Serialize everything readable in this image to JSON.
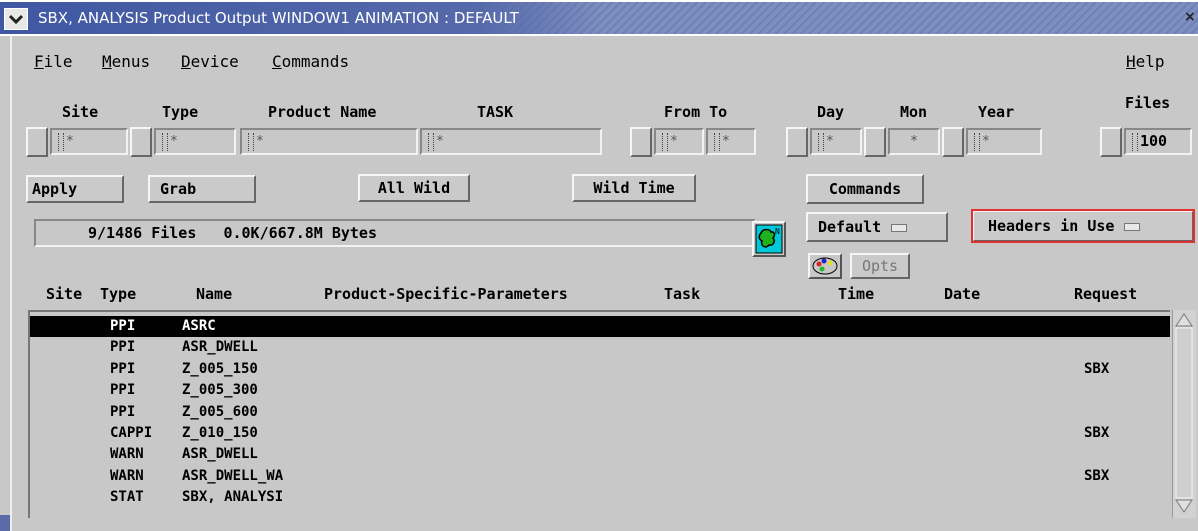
{
  "window": {
    "title": "SBX, ANALYSIS   Product Output WINDOW1 ANIMATION : DEFAULT",
    "close_glyph": "×"
  },
  "menubar": {
    "file": "File",
    "menus": "Menus",
    "device": "Device",
    "commands": "Commands",
    "help": "Help"
  },
  "filters": {
    "site_label": "Site",
    "type_label": "Type",
    "product_name_label": "Product Name",
    "task_label": "TASK",
    "from_to_label": "From To",
    "day_label": "Day",
    "mon_label": "Mon",
    "year_label": "Year",
    "files_label": "Files",
    "site_value": "*",
    "type_value": "*",
    "product_name_value": "*",
    "task_value": "*",
    "from_value": "*",
    "to_value": "*",
    "day_value": "*",
    "mon_value": "*",
    "year_value": "*",
    "files_value": "100"
  },
  "buttons": {
    "apply": "Apply",
    "grab": "Grab",
    "all_wild": "All Wild",
    "wild_time": "Wild Time",
    "commands": "Commands",
    "default_menu": "Default",
    "headers_menu": "Headers in Use",
    "opts": "Opts"
  },
  "status": {
    "text": "9/1486 Files   0.0K/667.8M Bytes"
  },
  "list": {
    "columns": {
      "site": "Site",
      "type": "Type",
      "name": "Name",
      "params": "Product-Specific-Parameters",
      "task": "Task",
      "time": "Time",
      "date": "Date",
      "request": "Request"
    },
    "rows": [
      {
        "type": "PPI",
        "name": "ASRC",
        "request": "",
        "selected": true
      },
      {
        "type": "PPI",
        "name": "ASR_DWELL",
        "request": ""
      },
      {
        "type": "PPI",
        "name": "Z_005_150",
        "request": "SBX"
      },
      {
        "type": "PPI",
        "name": "Z_005_300",
        "request": ""
      },
      {
        "type": "PPI",
        "name": "Z_005_600",
        "request": ""
      },
      {
        "type": "CAPPI",
        "name": "Z_010_150",
        "request": "SBX"
      },
      {
        "type": "WARN",
        "name": "ASR_DWELL",
        "request": ""
      },
      {
        "type": "WARN",
        "name": "ASR_DWELL_WA",
        "request": "SBX"
      },
      {
        "type": "STAT",
        "name": "SBX, ANALYSI",
        "request": ""
      }
    ]
  },
  "colors": {
    "title_blue": "#3f58a2",
    "selection": "#000000",
    "highlight_border": "#e03030",
    "map_icon_bg": "#00c8d8",
    "map_icon_fg": "#1fb21f"
  }
}
